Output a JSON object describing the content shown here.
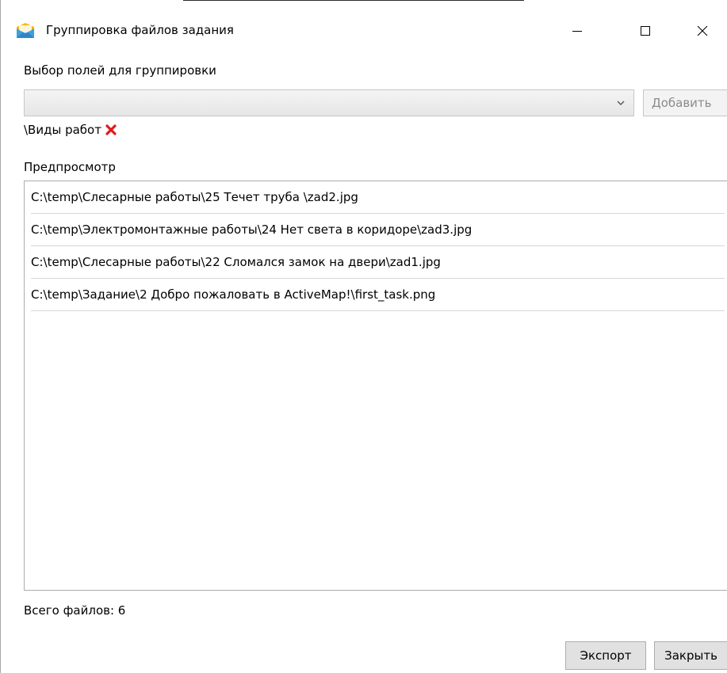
{
  "window": {
    "title": "Группировка файлов задания",
    "controls": [
      "minimize-icon",
      "maximize-icon",
      "close-icon"
    ]
  },
  "grouping": {
    "label": "Выбор полей для группировки",
    "combo_value": "",
    "add_label": "Добавить",
    "selected_fields": [
      {
        "label": "\\Виды работ",
        "remove_icon": "remove-x-icon",
        "remove_color": "#e01b1b"
      }
    ]
  },
  "preview": {
    "label": "Предпросмотр",
    "rows": [
      "C:\\temp\\Слесарные работы\\25 Течет труба \\zad2.jpg",
      "C:\\temp\\Электромонтажные работы\\24 Нет света в коридоре\\zad3.jpg",
      "C:\\temp\\Слесарные работы\\22 Сломался замок на двери\\zad1.jpg",
      "C:\\temp\\Задание\\2 Добро пожаловать в ActiveMap!\\first_task.png"
    ]
  },
  "total": {
    "text": "Всего файлов: 6"
  },
  "buttons": {
    "export": "Экспорт",
    "close": "Закрыть"
  },
  "colors": {
    "icon_yellow": "#f5b800",
    "icon_blue": "#3aa0e0",
    "remove_red": "#e01b1b"
  }
}
